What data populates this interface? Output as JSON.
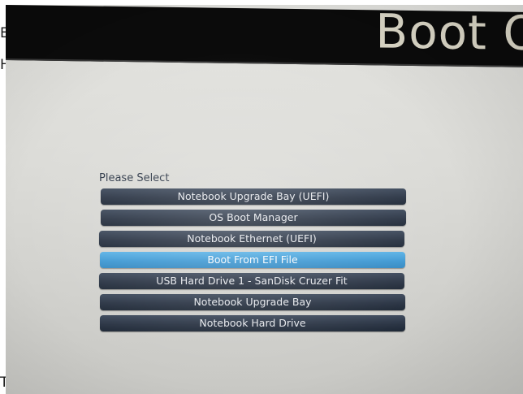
{
  "left_edge_text": [
    "E",
    "H",
    "T"
  ],
  "screen": {
    "title": "Boot O"
  },
  "boot_menu": {
    "prompt": "Please Select",
    "selected_index": 3,
    "items": [
      {
        "label": "Notebook Upgrade Bay (UEFI)"
      },
      {
        "label": "OS Boot Manager"
      },
      {
        "label": "Notebook Ethernet (UEFI)"
      },
      {
        "label": "Boot From EFI File"
      },
      {
        "label": "USB Hard Drive 1 - SanDisk Cruzer Fit"
      },
      {
        "label": "Notebook Upgrade Bay"
      },
      {
        "label": "Notebook Hard Drive"
      }
    ]
  },
  "colors": {
    "header": "#0b0b0b",
    "background": "#dcdcd8",
    "item": "#2a3444",
    "item_selected": "#3d98d3",
    "item_text": "#e6e8ec"
  }
}
